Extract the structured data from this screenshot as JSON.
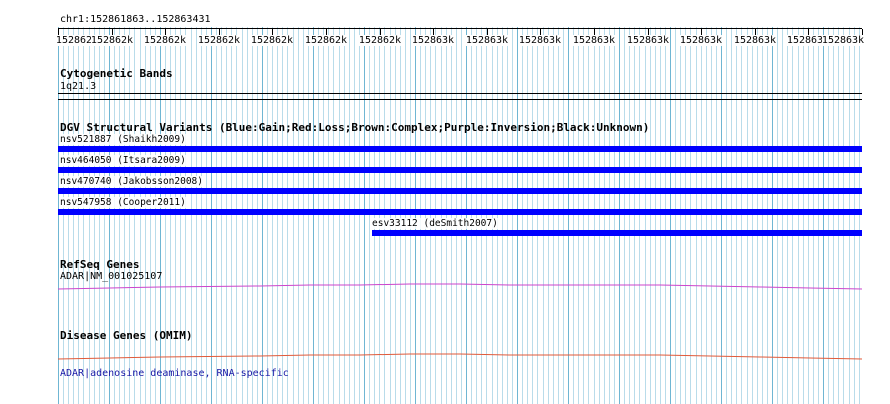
{
  "locus": "chr1:152861863..152863431",
  "ruler": {
    "labels": [
      "152862k",
      "152862k",
      "152862k",
      "152862k",
      "152862k",
      "152862k",
      "152862k",
      "152863k",
      "152863k",
      "152863k",
      "152863k",
      "152863k",
      "152863k",
      "152863k",
      "152863k",
      "152863k"
    ]
  },
  "tracks": {
    "cytoband": {
      "title": "Cytogenetic Bands",
      "band": "1q21.3"
    },
    "dgv": {
      "title": "DGV Structural Variants (Blue:Gain;Red:Loss;Brown:Complex;Purple:Inversion;Black:Unknown)",
      "features": [
        {
          "label": "nsv521887 (Shaikh2009)",
          "type": "Gain",
          "color": "#0000ff"
        },
        {
          "label": "nsv464050 (Itsara2009)",
          "type": "Gain",
          "color": "#0000ff"
        },
        {
          "label": "nsv470740 (Jakobsson2008)",
          "type": "Gain",
          "color": "#0000ff"
        },
        {
          "label": "nsv547958 (Cooper2011)",
          "type": "Gain",
          "color": "#0000ff"
        },
        {
          "label": "esv33112 (deSmith2007)",
          "type": "Gain",
          "color": "#0000ff"
        }
      ]
    },
    "refseq": {
      "title": "RefSeq Genes",
      "gene_label": "ADAR|NM_001025107",
      "color": "#cc44cc"
    },
    "omim": {
      "title": "Disease Genes (OMIM)",
      "gene_label": "ADAR|adenosine deaminase, RNA-specific",
      "color": "#e05a3a",
      "label_color": "#1a1aa6"
    }
  },
  "colors": {
    "grid_major": "#6fb6d3",
    "grid_minor": "#b9dcea",
    "gain": "#0000ff"
  }
}
